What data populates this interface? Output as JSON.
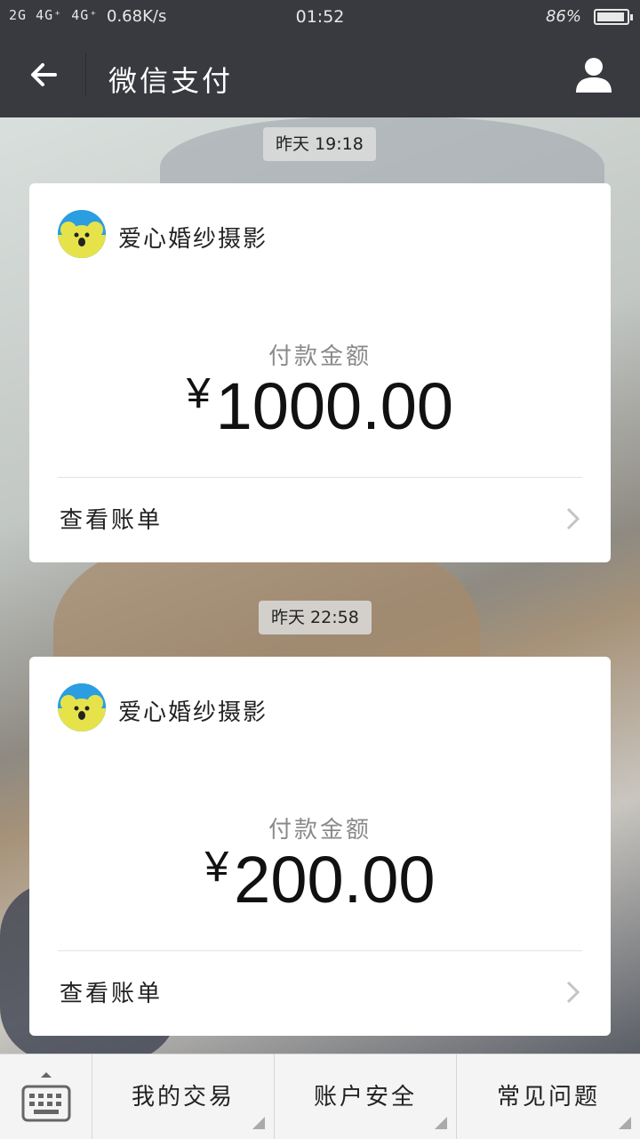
{
  "status_bar": {
    "signal": "2G 4G⁺ 4G⁺",
    "speed": "0.68K/s",
    "time": "01:52",
    "battery": "86%"
  },
  "header": {
    "title": "微信支付",
    "back_icon": "arrow-left-icon",
    "user_icon": "user-icon"
  },
  "messages": [
    {
      "time": "昨天 19:18",
      "merchant": "爱心婚纱摄影",
      "amount_label": "付款金额",
      "currency": "¥",
      "amount": "1000.00",
      "action": "查看账单"
    },
    {
      "time": "昨天 22:58",
      "merchant": "爱心婚纱摄影",
      "amount_label": "付款金额",
      "currency": "¥",
      "amount": "200.00",
      "action": "查看账单"
    }
  ],
  "bottom_menu": {
    "keyboard_icon": "keyboard-icon",
    "items": [
      "我的交易",
      "账户安全",
      "常见问题"
    ]
  },
  "colors": {
    "header_bg": "#393a3f",
    "card_bg": "#ffffff",
    "avatar_bg": "#2a9ee0"
  }
}
